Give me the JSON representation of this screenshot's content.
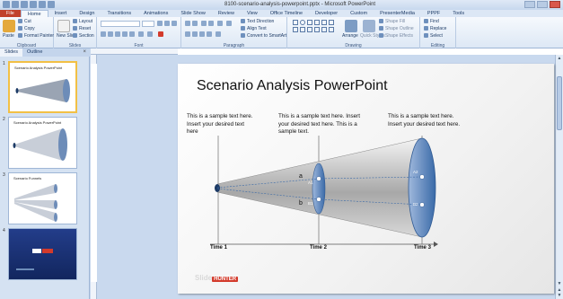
{
  "window": {
    "title": "8100-scenario-analysis-powerpoint.pptx - Microsoft PowerPoint"
  },
  "ribbon_tabs": [
    {
      "label": "File",
      "active": false
    },
    {
      "label": "Home",
      "active": true
    },
    {
      "label": "Insert",
      "active": false
    },
    {
      "label": "Design",
      "active": false
    },
    {
      "label": "Transitions",
      "active": false
    },
    {
      "label": "Animations",
      "active": false
    },
    {
      "label": "Slide Show",
      "active": false
    },
    {
      "label": "Review",
      "active": false
    },
    {
      "label": "View",
      "active": false
    },
    {
      "label": "Office Timeline",
      "active": false
    },
    {
      "label": "Developer",
      "active": false
    },
    {
      "label": "Custom",
      "active": false
    },
    {
      "label": "PresenterMedia",
      "active": false
    },
    {
      "label": "PPPF",
      "active": false
    },
    {
      "label": "Tools",
      "active": false
    }
  ],
  "clipboard": {
    "paste": "Paste",
    "cut": "Cut",
    "copy": "Copy",
    "format_painter": "Format Painter",
    "label": "Clipboard"
  },
  "slides_group": {
    "new_slide": "New Slide",
    "layout": "Layout",
    "reset": "Reset",
    "section": "Section",
    "label": "Slides"
  },
  "font_group": {
    "label": "Font"
  },
  "paragraph_group": {
    "text_direction": "Text Direction",
    "align_text": "Align Text",
    "convert_smartart": "Convert to SmartArt",
    "label": "Paragraph"
  },
  "drawing_group": {
    "arrange": "Arrange",
    "quick_styles": "Quick Styles",
    "shape_fill": "Shape Fill",
    "shape_outline": "Shape Outline",
    "shape_effects": "Shape Effects",
    "label": "Drawing"
  },
  "editing_group": {
    "find": "Find",
    "replace": "Replace",
    "select": "Select",
    "label": "Editing"
  },
  "panel": {
    "tab_slides": "Slides",
    "tab_outline": "Outline",
    "close": "×"
  },
  "thumbnails": [
    {
      "num": "1",
      "title": "Scenario Analysis PowerPoint"
    },
    {
      "num": "2",
      "title": "Scenario Analysis PowerPoint"
    },
    {
      "num": "3",
      "title": "Scenario Funnels"
    },
    {
      "num": "4",
      "title": ""
    }
  ],
  "slide": {
    "title": "Scenario Analysis PowerPoint",
    "text1": "This is a sample text here. Insert your desired text here",
    "text2": "This is a sample text here. Insert your desired text here. This is a sample text.",
    "text3": "This is a sample text here. Insert your desired text here.",
    "time1": "Time 1",
    "time2": "Time 2",
    "time3": "Time 3",
    "label_a": "a",
    "label_b": "b",
    "label_a1": "A1",
    "label_b1": "B1",
    "label_a2": "A2",
    "label_b2": "B2",
    "logo_slide": "Slide",
    "logo_hunter": "HUNTER"
  },
  "colors": {
    "file_tab": "#c1412b",
    "cone_blue": "#3a6aa8",
    "selection": "#f2c045"
  }
}
